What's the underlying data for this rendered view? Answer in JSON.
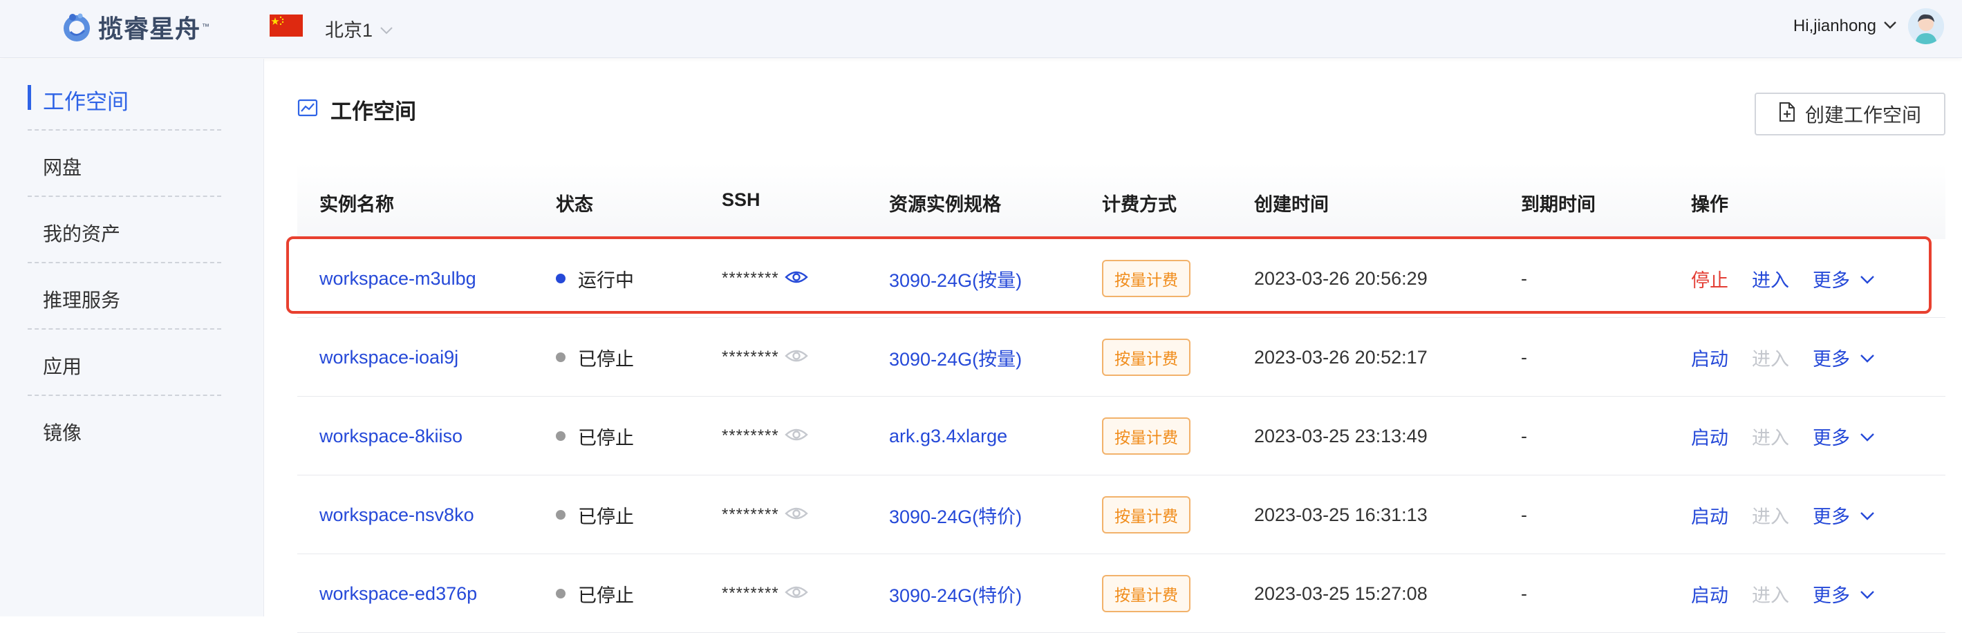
{
  "brand": {
    "name": "揽睿星舟",
    "tm": "™"
  },
  "region": {
    "label": "北京1"
  },
  "user": {
    "greeting": "Hi,jianhong"
  },
  "sidebar": {
    "items": [
      {
        "label": "工作空间",
        "active": true
      },
      {
        "label": "网盘"
      },
      {
        "label": "我的资产"
      },
      {
        "label": "推理服务"
      },
      {
        "label": "应用"
      },
      {
        "label": "镜像"
      }
    ]
  },
  "main": {
    "title": "工作空间",
    "create_label": "创建工作空间",
    "columns": [
      "实例名称",
      "状态",
      "SSH",
      "资源实例规格",
      "计费方式",
      "创建时间",
      "到期时间",
      "操作"
    ],
    "rows": [
      {
        "name": "workspace-m3ulbg",
        "status": "运行中",
        "ssh": "********",
        "spec": "3090-24G(按量)",
        "billing": "按量计费",
        "created": "2023-03-26 20:56:29",
        "expire": "-",
        "primary_op": "停止",
        "enter": "进入",
        "more": "更多"
      },
      {
        "name": "workspace-ioai9j",
        "status": "已停止",
        "ssh": "********",
        "spec": "3090-24G(按量)",
        "billing": "按量计费",
        "created": "2023-03-26 20:52:17",
        "expire": "-",
        "primary_op": "启动",
        "enter": "进入",
        "more": "更多"
      },
      {
        "name": "workspace-8kiiso",
        "status": "已停止",
        "ssh": "********",
        "spec": "ark.g3.4xlarge",
        "billing": "按量计费",
        "created": "2023-03-25 23:13:49",
        "expire": "-",
        "primary_op": "启动",
        "enter": "进入",
        "more": "更多"
      },
      {
        "name": "workspace-nsv8ko",
        "status": "已停止",
        "ssh": "********",
        "spec": "3090-24G(特价)",
        "billing": "按量计费",
        "created": "2023-03-25 16:31:13",
        "expire": "-",
        "primary_op": "启动",
        "enter": "进入",
        "more": "更多"
      },
      {
        "name": "workspace-ed376p",
        "status": "已停止",
        "ssh": "********",
        "spec": "3090-24G(特价)",
        "billing": "按量计费",
        "created": "2023-03-25 15:27:08",
        "expire": "-",
        "primary_op": "启动",
        "enter": "进入",
        "more": "更多"
      }
    ]
  },
  "colors": {
    "accent": "#2e63e6",
    "link": "#2549d8",
    "running": "#2549d8",
    "stopped": "#9a9a9a",
    "stop_action": "#e33d34",
    "billing_tag": "#f08c1b",
    "highlight": "#e8402f"
  },
  "icons": {
    "logo": "brand-logo-icon",
    "flag": "china-flag-icon",
    "eye": "eye-icon",
    "chevron": "chevron-down-icon",
    "chart": "line-chart-icon",
    "doc": "document-add-icon"
  }
}
